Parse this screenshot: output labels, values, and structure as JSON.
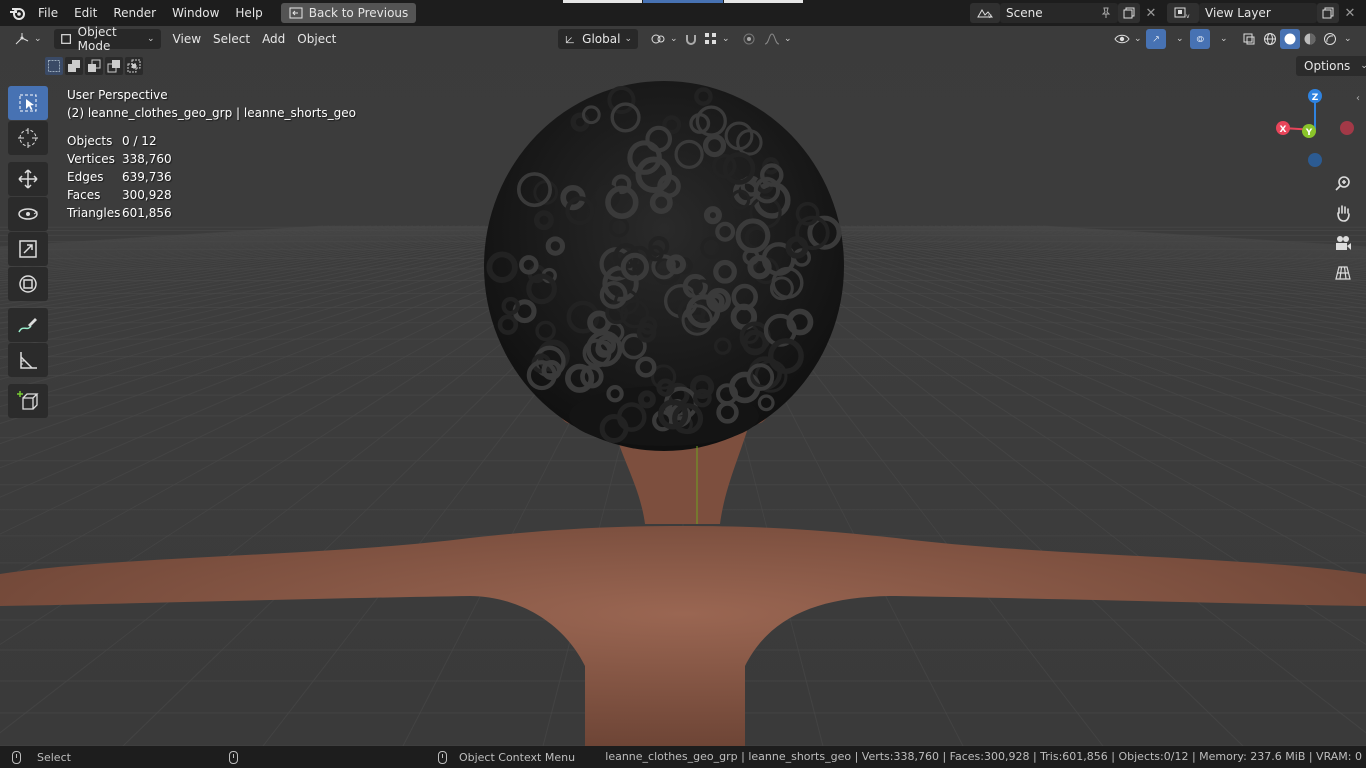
{
  "menu": {
    "items": [
      "File",
      "Edit",
      "Render",
      "Window",
      "Help"
    ],
    "back_label": "Back to Previous"
  },
  "scene": {
    "name": "Scene",
    "view_layer": "View Layer"
  },
  "viewport_header": {
    "mode": "Object Mode",
    "menus": [
      "View",
      "Select",
      "Add",
      "Object"
    ],
    "orientation": "Global"
  },
  "options_label": "Options",
  "overlay": {
    "perspective": "User Perspective",
    "active_object": "(2) leanne_clothes_geo_grp | leanne_shorts_geo",
    "stats": [
      {
        "label": "Objects",
        "value": "0 / 12"
      },
      {
        "label": "Vertices",
        "value": "338,760"
      },
      {
        "label": "Edges",
        "value": "639,736"
      },
      {
        "label": "Faces",
        "value": "300,928"
      },
      {
        "label": "Triangles",
        "value": "601,856"
      }
    ]
  },
  "gizmo": {
    "x": "X",
    "y": "Y",
    "z": "Z"
  },
  "tools": [
    "select-box-icon",
    "cursor-icon",
    "move-icon",
    "rotate-icon",
    "scale-icon",
    "transform-icon",
    "annotate-icon",
    "measure-icon",
    "add-cube-icon"
  ],
  "statusbar": {
    "select": "Select",
    "context_menu": "Object Context Menu",
    "info": "leanne_clothes_geo_grp | leanne_shorts_geo | Verts:338,760 | Faces:300,928 | Tris:601,856 | Objects:0/12 | Memory: 237.6 MiB | VRAM: 0"
  },
  "colors": {
    "accent": "#4772b3",
    "axis_x": "#e8455a",
    "axis_y": "#8ac42a",
    "axis_z": "#2f83e0",
    "skin": "#8a5a48",
    "hair": "#1a1a1a"
  }
}
